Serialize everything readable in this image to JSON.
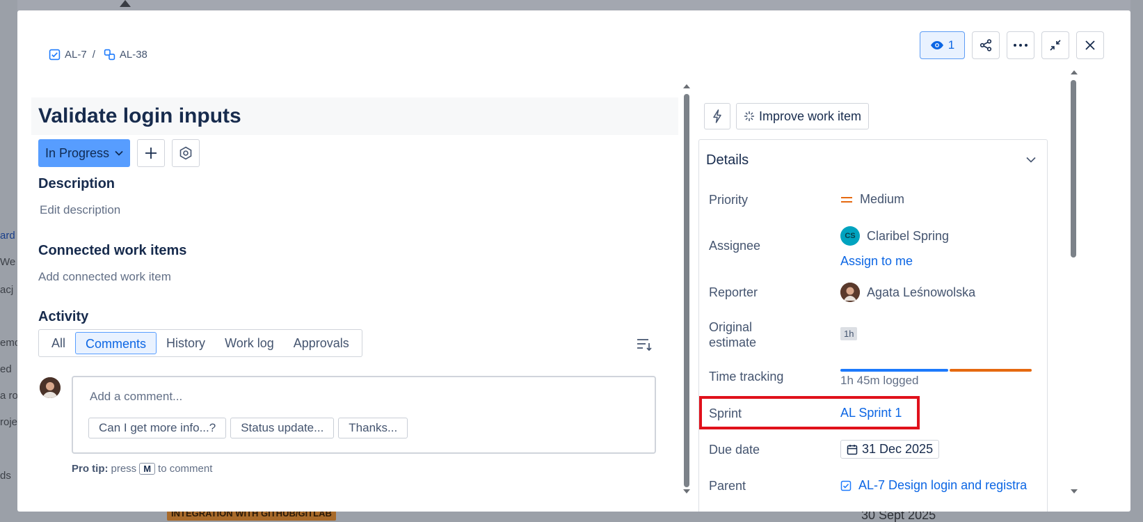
{
  "background": {
    "left_items": [
      "ard",
      "We",
      "acj",
      "emo",
      "ed",
      "a ro",
      "roje",
      "ds"
    ],
    "tag": "INTEGRATION WITH GITHUB/GITLAB",
    "date": "30 Sept 2025"
  },
  "breadcrumb": {
    "parent_key": "AL-7",
    "separator": "/",
    "item_key": "AL-38"
  },
  "top_actions": {
    "watch_count": "1"
  },
  "issue": {
    "title": "Validate login inputs",
    "status": "In Progress"
  },
  "description": {
    "heading": "Description",
    "placeholder": "Edit description"
  },
  "connected": {
    "heading": "Connected work items",
    "placeholder": "Add connected work item"
  },
  "activity": {
    "heading": "Activity",
    "tabs": [
      "All",
      "Comments",
      "History",
      "Work log",
      "Approvals"
    ],
    "active_tab": "Comments",
    "comment_placeholder": "Add a comment...",
    "quick_replies": [
      "Can I get more info...?",
      "Status update...",
      "Thanks..."
    ],
    "protip_label": "Pro tip:",
    "protip_press": "press",
    "protip_key": "M",
    "protip_suffix": "to comment"
  },
  "ai": {
    "improve_label": "Improve work item"
  },
  "details": {
    "heading": "Details",
    "priority_label": "Priority",
    "priority_value": "Medium",
    "assignee_label": "Assignee",
    "assignee_initials": "CS",
    "assignee_name": "Claribel Spring",
    "assign_to_me": "Assign to me",
    "reporter_label": "Reporter",
    "reporter_name": "Agata Leśnowolska",
    "original_estimate_label_1": "Original",
    "original_estimate_label_2": "estimate",
    "original_estimate_value": "1h",
    "time_tracking_label": "Time tracking",
    "time_logged": "1h 45m logged",
    "sprint_label": "Sprint",
    "sprint_value": "AL Sprint 1",
    "due_label": "Due date",
    "due_value": "31 Dec 2025",
    "parent_label": "Parent",
    "parent_value": "AL-7 Design login and registra"
  },
  "colors": {
    "status_bg": "#579dff",
    "link": "#0c66e4",
    "highlight": "#e0111b",
    "priority_medium": "#e56910"
  }
}
